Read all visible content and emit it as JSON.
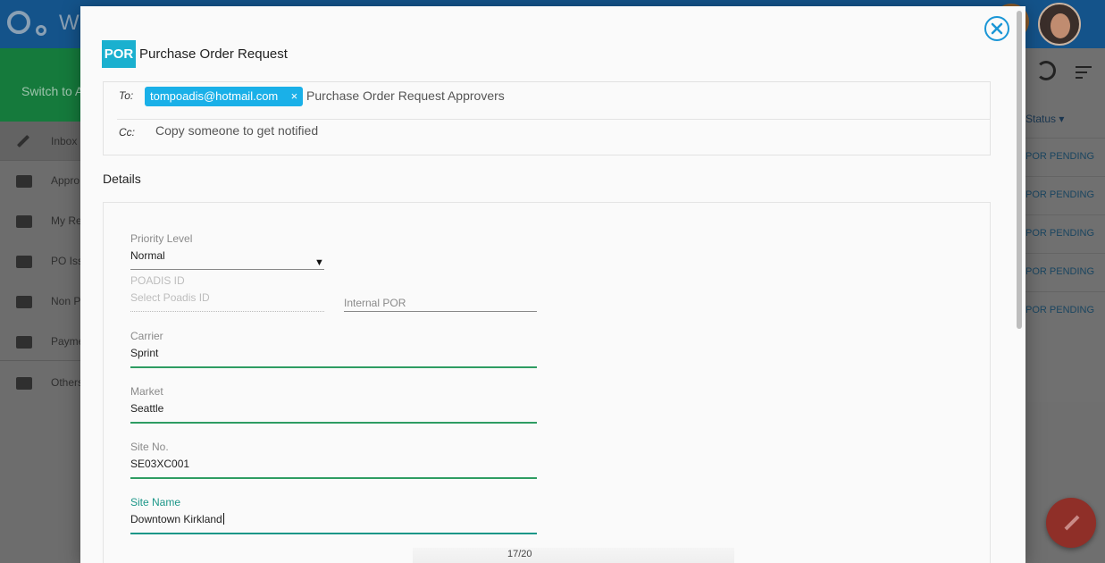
{
  "app": {
    "brand": "Wi",
    "switch_label": "Switch to A"
  },
  "sidebar": {
    "items": [
      {
        "label": "Inbox",
        "icon": "pencil-icon"
      },
      {
        "label": "Appro",
        "icon": "folder-icon"
      },
      {
        "label": "My Re",
        "icon": "folder-icon"
      },
      {
        "label": "PO Iss",
        "icon": "folder-icon"
      },
      {
        "label": "Non P",
        "icon": "folder-icon"
      },
      {
        "label": "Payme",
        "icon": "folder-icon"
      },
      {
        "label": "Others",
        "icon": "folder-icon"
      }
    ]
  },
  "right_panel": {
    "status_header": "Status ▾",
    "rows": [
      "POR PENDING",
      "POR PENDING",
      "POR PENDING",
      "POR PENDING",
      "POR PENDING"
    ]
  },
  "modal": {
    "badge": "POR",
    "title": "Purchase Order Request",
    "to_label": "To:",
    "to_chip": "tompoadis@hotmail.com",
    "chip_close": "×",
    "to_group": "Purchase Order Request Approvers",
    "cc_label": "Cc:",
    "cc_placeholder": "Copy someone to get notified",
    "details_heading": "Details",
    "fields": {
      "priority": {
        "label": "Priority Level",
        "value": "Normal"
      },
      "poadis": {
        "label": "POADIS ID",
        "placeholder": "Select Poadis ID"
      },
      "internal": {
        "label": "Internal POR"
      },
      "carrier": {
        "label": "Carrier",
        "value": "Sprint"
      },
      "market": {
        "label": "Market",
        "value": "Seattle"
      },
      "site_no": {
        "label": "Site No.",
        "value": "SE03XC001"
      },
      "site_name": {
        "label": "Site Name",
        "value": "Downtown Kirkland"
      }
    },
    "char_counter": "17/20"
  },
  "colors": {
    "accent_blue": "#1ab0e8",
    "badge_teal": "#1ab0cf",
    "valid_green": "#2e9c62",
    "focus_teal": "#1b9688",
    "close_blue": "#1a96d6"
  }
}
